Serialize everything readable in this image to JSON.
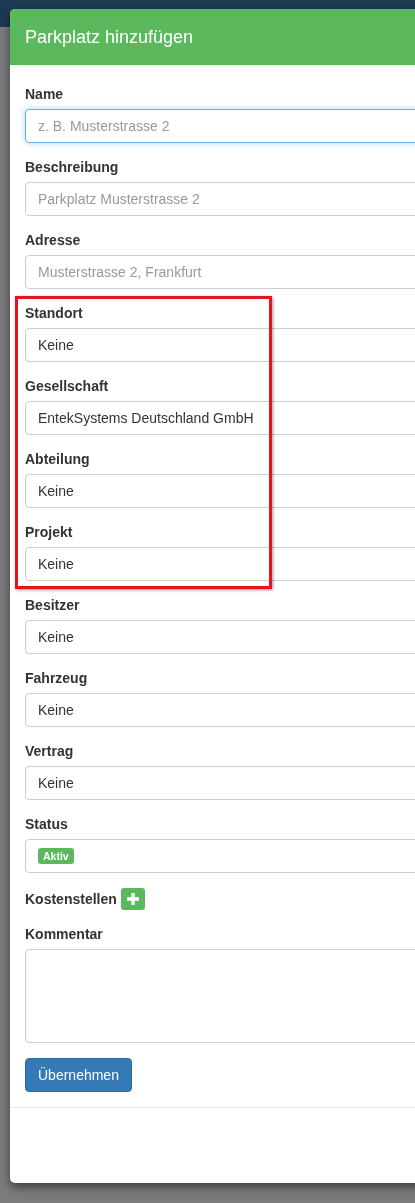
{
  "modal": {
    "title": "Parkplatz hinzufügen"
  },
  "fields": [
    {
      "kind": "input",
      "label": "Name",
      "placeholder": "z. B. Musterstrasse 2",
      "focused": true,
      "highlighted": false
    },
    {
      "kind": "input",
      "label": "Beschreibung",
      "placeholder": "Parkplatz Musterstrasse 2",
      "focused": false,
      "highlighted": false
    },
    {
      "kind": "input",
      "label": "Adresse",
      "placeholder": "Musterstrasse 2, Frankfurt",
      "focused": false,
      "highlighted": false
    },
    {
      "kind": "select",
      "label": "Standort",
      "value": "Keine",
      "highlighted": true
    },
    {
      "kind": "select",
      "label": "Gesellschaft",
      "value": "EntekSystems Deutschland GmbH",
      "highlighted": true
    },
    {
      "kind": "select",
      "label": "Abteilung",
      "value": "Keine",
      "highlighted": true
    },
    {
      "kind": "select",
      "label": "Projekt",
      "value": "Keine",
      "highlighted": true
    },
    {
      "kind": "select",
      "label": "Besitzer",
      "value": "Keine",
      "highlighted": false
    },
    {
      "kind": "select",
      "label": "Fahrzeug",
      "value": "Keine",
      "highlighted": false
    },
    {
      "kind": "select",
      "label": "Vertrag",
      "value": "Keine",
      "highlighted": false
    },
    {
      "kind": "status",
      "label": "Status",
      "value": "Aktiv",
      "highlighted": false
    },
    {
      "kind": "adder",
      "label": "Kostenstellen",
      "highlighted": false
    },
    {
      "kind": "textarea",
      "label": "Kommentar",
      "highlighted": false
    }
  ],
  "submit_button": "Übernehmen"
}
